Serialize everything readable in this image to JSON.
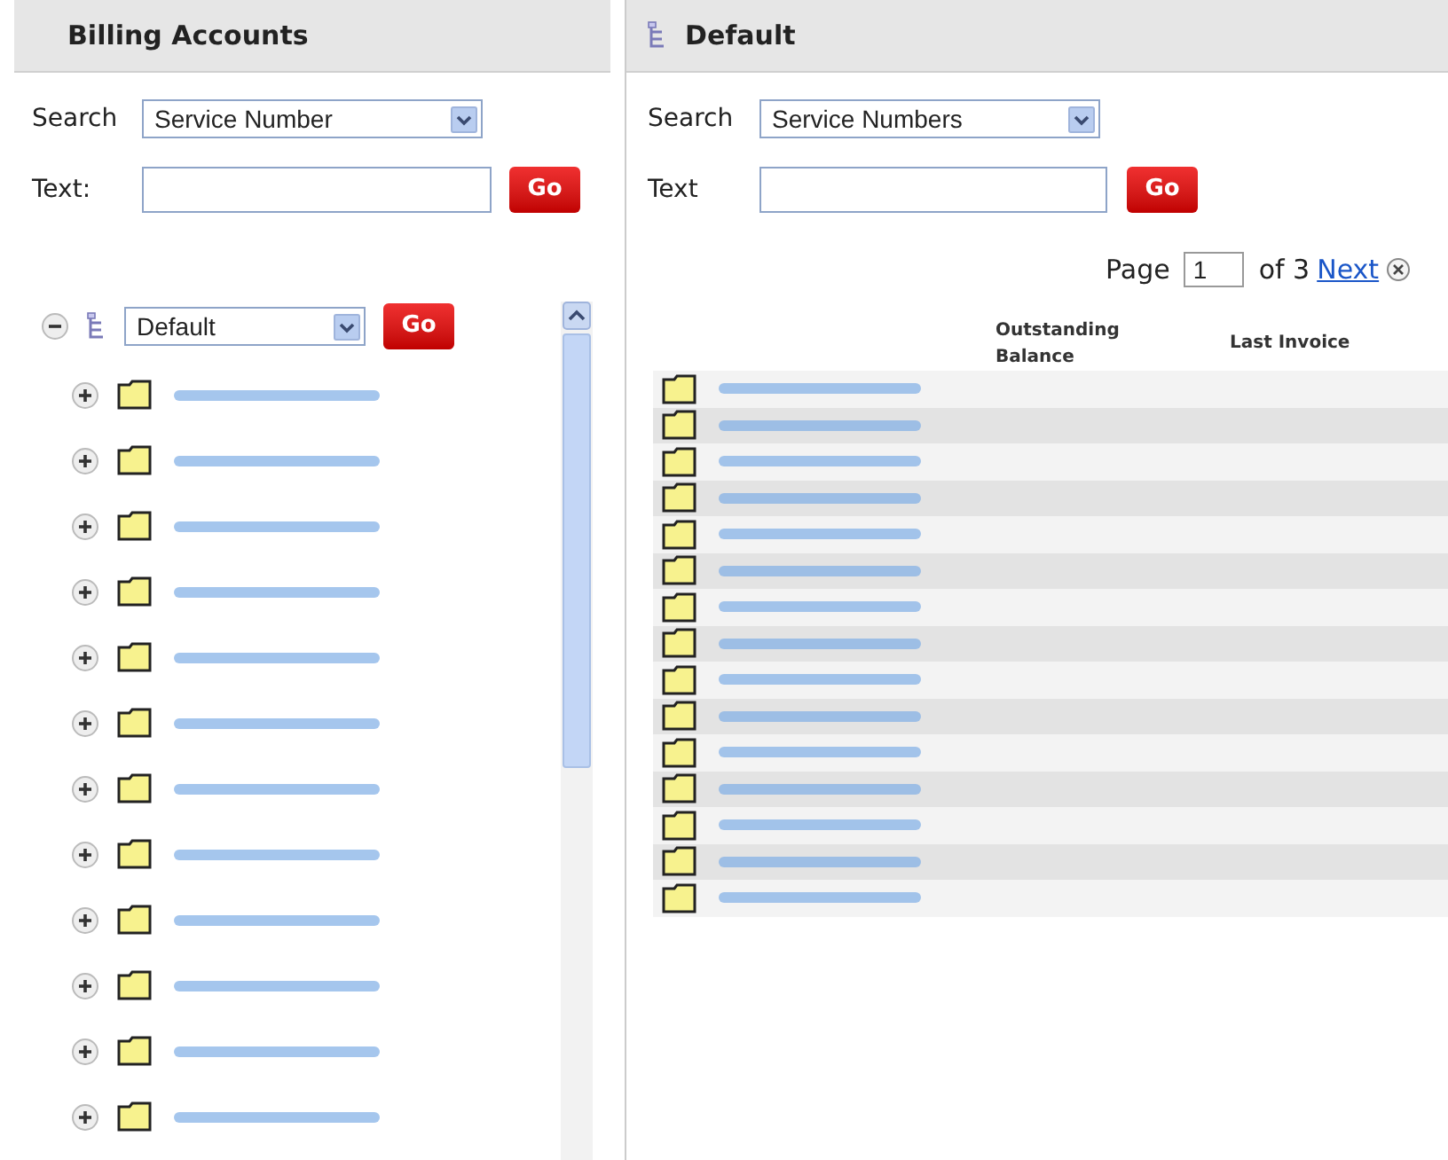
{
  "left_panel": {
    "title": "Billing Accounts",
    "search_label": "Search",
    "search_value": "Service Number",
    "text_label": "Text:",
    "go": "Go",
    "tree": {
      "expanded": true,
      "view_value": "Default",
      "go": "Go",
      "children": [
        {
          "kind": "folder",
          "expanded": false
        },
        {
          "kind": "folder",
          "expanded": false
        },
        {
          "kind": "folder",
          "expanded": false
        },
        {
          "kind": "folder",
          "expanded": false
        },
        {
          "kind": "folder",
          "expanded": false
        },
        {
          "kind": "folder",
          "expanded": false
        },
        {
          "kind": "folder",
          "expanded": false
        },
        {
          "kind": "folder",
          "expanded": false
        },
        {
          "kind": "folder",
          "expanded": false
        },
        {
          "kind": "folder",
          "expanded": false
        },
        {
          "kind": "folder",
          "expanded": false
        },
        {
          "kind": "folder",
          "expanded": false
        }
      ]
    }
  },
  "right_panel": {
    "title": "Default",
    "search_label": "Search",
    "search_value": "Service Numbers",
    "text_label": "Text",
    "go": "Go",
    "pager": {
      "page_label": "Page",
      "page_value": "1",
      "of": "of 3",
      "next": "Next"
    },
    "table": {
      "columns": [
        "Outstanding Balance",
        "Last Invoice"
      ],
      "rows": [
        {
          "kind": "folder"
        },
        {
          "kind": "folder"
        },
        {
          "kind": "folder"
        },
        {
          "kind": "folder"
        },
        {
          "kind": "folder"
        },
        {
          "kind": "folder"
        },
        {
          "kind": "folder"
        },
        {
          "kind": "folder"
        },
        {
          "kind": "folder"
        },
        {
          "kind": "folder"
        },
        {
          "kind": "folder"
        },
        {
          "kind": "folder"
        },
        {
          "kind": "folder"
        },
        {
          "kind": "folder"
        },
        {
          "kind": "folder"
        }
      ]
    }
  }
}
